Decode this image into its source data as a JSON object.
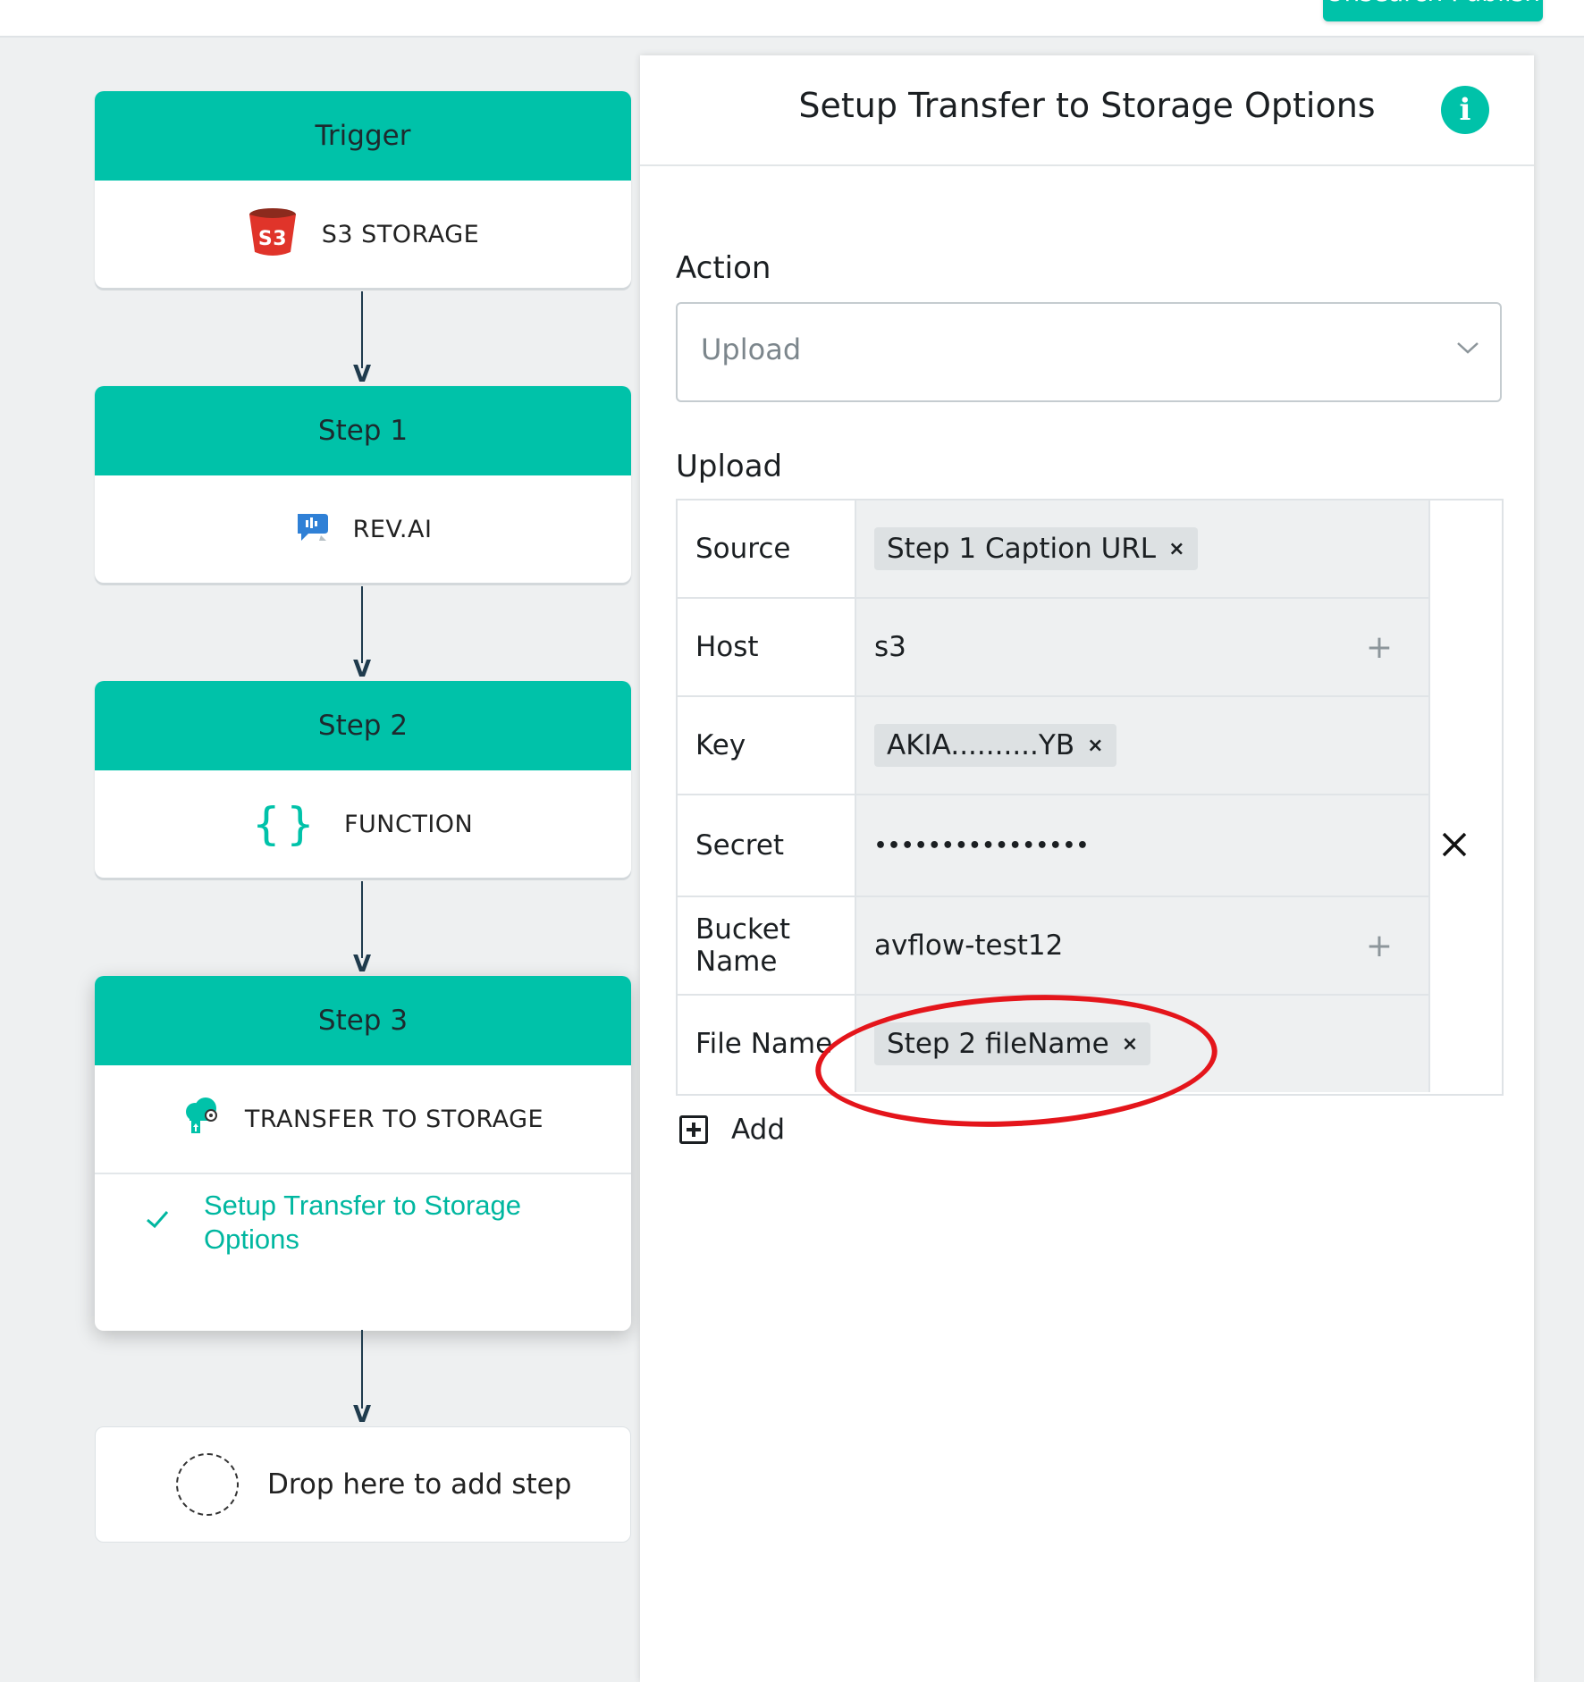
{
  "topbar": {
    "publish_label": "Unsearch Publish"
  },
  "flow": {
    "trigger": {
      "header": "Trigger",
      "service": "S3 STORAGE",
      "icon": "s3-bucket-icon"
    },
    "steps": [
      {
        "header": "Step 1",
        "service": "REV.AI",
        "icon": "revai-icon"
      },
      {
        "header": "Step 2",
        "service": "FUNCTION",
        "icon": "curly-braces-icon"
      },
      {
        "header": "Step 3",
        "service": "TRANSFER TO STORAGE",
        "icon": "cloud-transfer-icon",
        "option": "Setup Transfer to Storage Options",
        "option_completed": true
      }
    ],
    "drop_zone": "Drop here to add step"
  },
  "panel": {
    "title": "Setup Transfer to Storage Options",
    "info_icon": "i",
    "action_label": "Action",
    "action_value": "Upload",
    "upload_label": "Upload",
    "fields": {
      "source": {
        "label": "Source",
        "chip": "Step 1 Caption URL"
      },
      "host": {
        "label": "Host",
        "value": "s3"
      },
      "key": {
        "label": "Key",
        "chip": "AKIA..........YB"
      },
      "secret": {
        "label": "Secret",
        "value": "••••••••••••••••"
      },
      "bucket": {
        "label": "Bucket Name",
        "value": "avflow-test12"
      },
      "filename": {
        "label": "File Name",
        "chip": "Step 2 fileName"
      }
    },
    "chip_remove": "×",
    "plus": "+",
    "add_label": "Add"
  },
  "colors": {
    "accent": "#00c2a9",
    "annotation": "#e4151b"
  }
}
